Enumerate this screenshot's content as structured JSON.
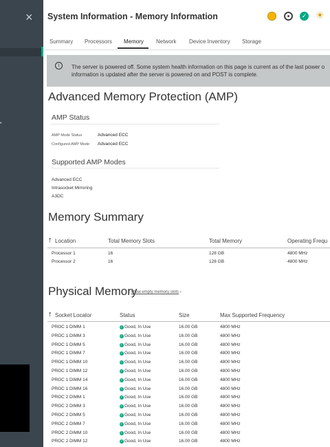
{
  "nav": {
    "close_glyph": "×"
  },
  "header": {
    "title": "System Information - Memory Information",
    "icons": [
      "power-icon",
      "target-icon",
      "ok-check-icon",
      "sun-icon"
    ]
  },
  "tabs": [
    "Summary",
    "Processors",
    "Memory",
    "Network",
    "Device Inventory",
    "Storage"
  ],
  "active_tab": "Memory",
  "banner": {
    "text": "The server is powered off. Some system health information on this page is current as of the last power o information is updated after the server is powered on and POST is complete."
  },
  "amp": {
    "title": "Advanced Memory Protection (AMP)",
    "status_title": "AMP Status",
    "mode_status_label": "AMP Mode Status",
    "mode_status_value": "Advanced ECC",
    "configured_label": "Configured AMP Mode",
    "configured_value": "Advanced ECC",
    "supported_title": "Supported AMP Modes",
    "supported": [
      "Advanced ECC",
      "Intrasocket Mirroring",
      "A3DC"
    ]
  },
  "summary": {
    "title": "Memory Summary",
    "headers": [
      "Location",
      "Total Memory Slots",
      "Total Memory",
      "Operating Frequ"
    ],
    "rows": [
      [
        "Processor 1",
        "16",
        "128 GB",
        "4800 MHz"
      ],
      [
        "Processor 2",
        "16",
        "128 GB",
        "4800 MHz"
      ]
    ]
  },
  "physical": {
    "title": "Physical Memory",
    "link_open": "‹",
    "link_text": "show empty memory slots",
    "link_close": "›",
    "headers": [
      "Socket Locator",
      "Status",
      "Size",
      "Max Supported Frequency"
    ],
    "status_color": "#01a982",
    "rows": [
      [
        "PROC 1 DIMM 1",
        "Good, In Use",
        "16.00 GB",
        "4800 MHz"
      ],
      [
        "PROC 1 DIMM 3",
        "Good, In Use",
        "16.00 GB",
        "4800 MHz"
      ],
      [
        "PROC 1 DIMM 5",
        "Good, In Use",
        "16.00 GB",
        "4800 MHz"
      ],
      [
        "PROC 1 DIMM 7",
        "Good, In Use",
        "16.00 GB",
        "4800 MHz"
      ],
      [
        "PROC 1 DIMM 10",
        "Good, In Use",
        "16.00 GB",
        "4800 MHz"
      ],
      [
        "PROC 1 DIMM 12",
        "Good, In Use",
        "16.00 GB",
        "4800 MHz"
      ],
      [
        "PROC 1 DIMM 14",
        "Good, In Use",
        "16.00 GB",
        "4800 MHz"
      ],
      [
        "PROC 1 DIMM 16",
        "Good, In Use",
        "16.00 GB",
        "4800 MHz"
      ],
      [
        "PROC 2 DIMM 1",
        "Good, In Use",
        "16.00 GB",
        "4800 MHz"
      ],
      [
        "PROC 2 DIMM 3",
        "Good, In Use",
        "16.00 GB",
        "4800 MHz"
      ],
      [
        "PROC 2 DIMM 5",
        "Good, In Use",
        "16.00 GB",
        "4800 MHz"
      ],
      [
        "PROC 2 DIMM 7",
        "Good, In Use",
        "16.00 GB",
        "4800 MHz"
      ],
      [
        "PROC 2 DIMM 10",
        "Good, In Use",
        "16.00 GB",
        "4800 MHz"
      ],
      [
        "PROC 2 DIMM 12",
        "Good, In Use",
        "16.00 GB",
        "4800 MHz"
      ]
    ]
  }
}
